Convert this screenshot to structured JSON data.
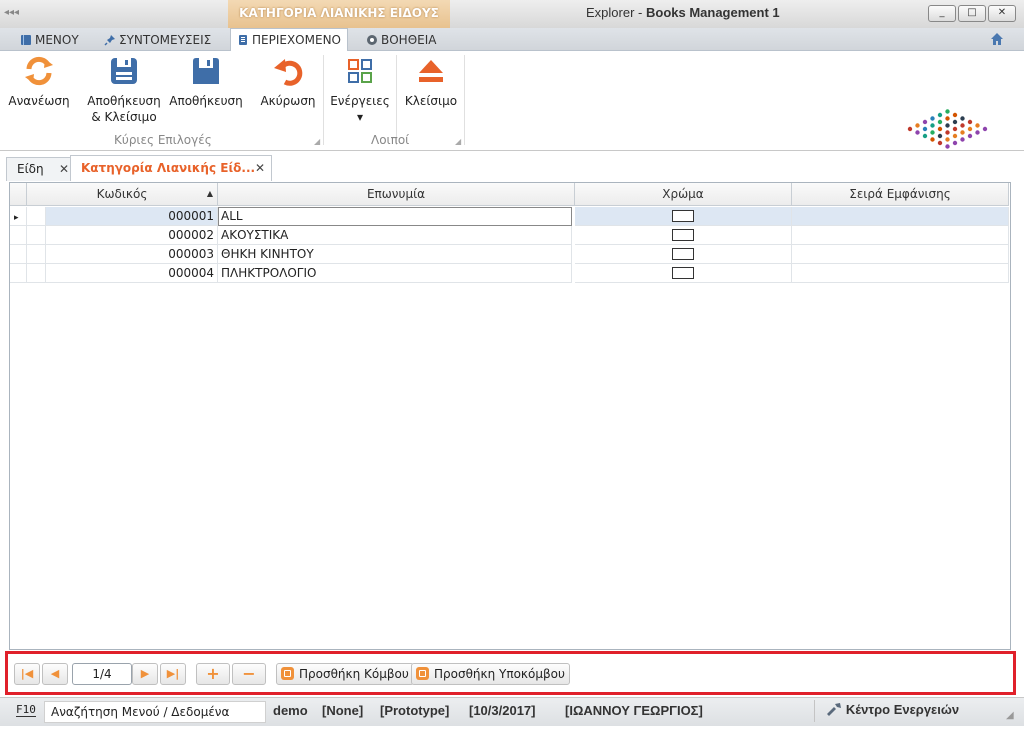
{
  "window": {
    "context_tab": "ΚΑΤΗΓΟΡΙΑ ΛΙΑΝΙΚΗΣ ΕΙΔΟΥΣ",
    "app_name": "Explorer",
    "title_sep": " - ",
    "doc_title": "Books Management 1",
    "controls": {
      "minimize": "_",
      "maximize": "□",
      "close": "✕"
    }
  },
  "menu": {
    "items": [
      {
        "label": "ΜΕΝΟΥ",
        "icon": "book-icon"
      },
      {
        "label": "ΣΥΝΤΟΜΕΥΣΕΙΣ",
        "icon": "pin-icon"
      },
      {
        "label": "ΠΕΡΙΕΧΟΜΕΝΟ",
        "icon": "document-icon"
      },
      {
        "label": "ΒΟΗΘΕΙΑ",
        "icon": "help-icon"
      }
    ],
    "active": "ΠΕΡΙΕΧΟΜΕΝΟ",
    "home_icon": "home-icon"
  },
  "ribbon": {
    "buttons": [
      {
        "label": "Ανανέωση",
        "icon": "refresh-icon"
      },
      {
        "label": "Αποθήκευση",
        "label2": "& Κλείσιμο",
        "icon": "save-close-icon"
      },
      {
        "label": "Αποθήκευση",
        "icon": "save-icon"
      },
      {
        "label": "Ακύρωση",
        "icon": "undo-icon"
      },
      {
        "label": "Ενέργειες",
        "dropdown": "▾",
        "icon": "actions-icon"
      },
      {
        "label": "Κλείσιμο",
        "icon": "eject-icon"
      }
    ],
    "groups": [
      "Κύριες Επιλογές",
      "Λοιποί"
    ]
  },
  "tabs": [
    {
      "label": "Είδη",
      "close": "✕"
    },
    {
      "label": "Κατηγορία Λιανικής Είδ...",
      "close": "✕"
    }
  ],
  "grid": {
    "columns": [
      "Κωδικός",
      "Επωνυμία",
      "Χρώμα",
      "Σειρά Εμφάνισης"
    ],
    "sort_indicator": "▲",
    "row_indicator": "▸",
    "rows": [
      {
        "code": "000001",
        "name": "ALL",
        "selected": true
      },
      {
        "code": "000002",
        "name": "ΑΚΟΥΣΤΙΚΑ"
      },
      {
        "code": "000003",
        "name": "ΘΗΚΗ ΚΙΝΗΤΟΥ"
      },
      {
        "code": "000004",
        "name": "ΠΛΗΚΤΡΟΛΟΓΙΟ"
      }
    ]
  },
  "navigator": {
    "page": "1/4",
    "first": "|◀",
    "prev": "◀",
    "next": "▶",
    "last": "▶|",
    "add": "+",
    "remove": "−",
    "add_node": "Προσθήκη Κόμβου",
    "add_subnode": "Προσθήκη Υποκόμβου"
  },
  "statusbar": {
    "key": "F10",
    "search_placeholder": "Αναζήτηση Μενού / Δεδομένα",
    "user": "demo",
    "none": "[None]",
    "prototype": "[Prototype]",
    "date": "[10/3/2017]",
    "person": "[ΙΩΑΝΝΟΥ ΓΕΩΡΓΙΟΣ]",
    "action_center": "Κέντρο Ενεργειών"
  },
  "colors": {
    "accent": "#e8622a",
    "icon_blue": "#3f6ea8",
    "icon_orange": "#f0913a",
    "highlight_border": "#e0202a"
  }
}
